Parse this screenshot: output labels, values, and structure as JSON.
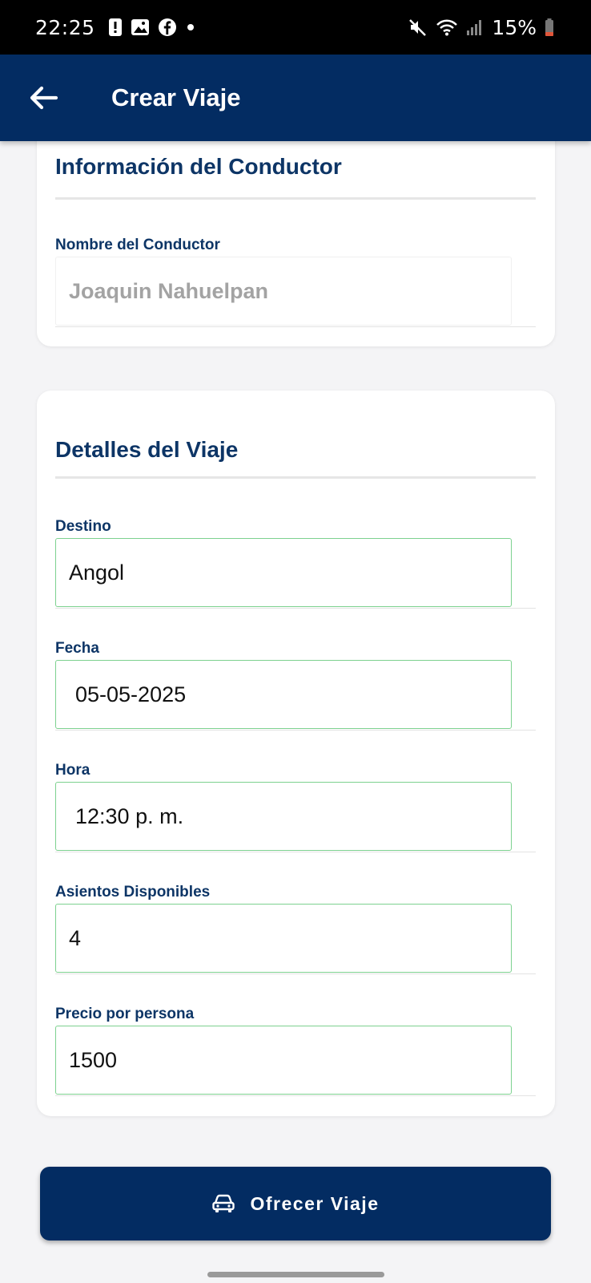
{
  "status_bar": {
    "time": "22:25",
    "battery": "15%",
    "icons": [
      "alert-icon",
      "gallery-icon",
      "facebook-icon",
      "dot-icon",
      "mute-icon",
      "wifi-icon",
      "signal-icon",
      "battery-icon"
    ]
  },
  "app_bar": {
    "title": "Crear Viaje",
    "back_icon": "arrow-left-icon",
    "color": "#032c62"
  },
  "driver_card": {
    "title": "Información del Conductor",
    "name_label": "Nombre del Conductor",
    "name_value": "Joaquin Nahuelpan"
  },
  "trip_card": {
    "title": "Detalles del Viaje",
    "fields": [
      {
        "label": "Destino",
        "value": "Angol"
      },
      {
        "label": "Fecha",
        "value": "05-05-2025"
      },
      {
        "label": "Hora",
        "value": "12:30 p. m."
      },
      {
        "label": "Asientos Disponibles",
        "value": "4"
      },
      {
        "label": "Precio por persona",
        "value": "1500"
      }
    ]
  },
  "offer_button": {
    "label": "Ofrecer Viaje",
    "icon": "car-icon"
  },
  "colors": {
    "primary": "#032c62",
    "heading": "#0d3566",
    "field_border": "#7dd18f"
  }
}
